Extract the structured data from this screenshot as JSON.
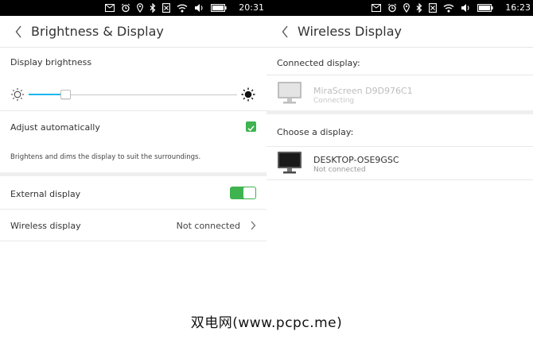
{
  "left": {
    "status": {
      "time": "20:31"
    },
    "header": {
      "title": "Brightness & Display"
    },
    "brightness": {
      "label": "Display brightness",
      "level": 0.18
    },
    "adjust": {
      "label": "Adjust automatically",
      "checked": true,
      "description": "Brightens and dims the display to suit the surroundings."
    },
    "external": {
      "label": "External display",
      "enabled": true
    },
    "wireless": {
      "label": "Wireless display",
      "value": "Not connected"
    }
  },
  "right": {
    "status": {
      "time": "16:23"
    },
    "header": {
      "title": "Wireless Display"
    },
    "connected_section": {
      "label": "Connected display:"
    },
    "connected_device": {
      "name": "MiraScreen D9D976C1",
      "status": "Connecting"
    },
    "choose_section": {
      "label": "Choose a display:"
    },
    "available_device": {
      "name": "DESKTOP-OSE9GSC",
      "status": "Not connected"
    }
  },
  "watermark": "双电网(www.pcpc.me)",
  "colors": {
    "accent": "#19b6ee",
    "toggle_on": "#3eb34f",
    "status_bar": "#000000"
  },
  "icons": [
    "mail-icon",
    "alarm-icon",
    "location-icon",
    "bluetooth-icon",
    "sim-icon",
    "wifi-icon",
    "volume-icon",
    "battery-icon",
    "back-icon",
    "sun-low-icon",
    "sun-high-icon",
    "check-icon",
    "chevron-right-icon",
    "monitor-icon"
  ]
}
